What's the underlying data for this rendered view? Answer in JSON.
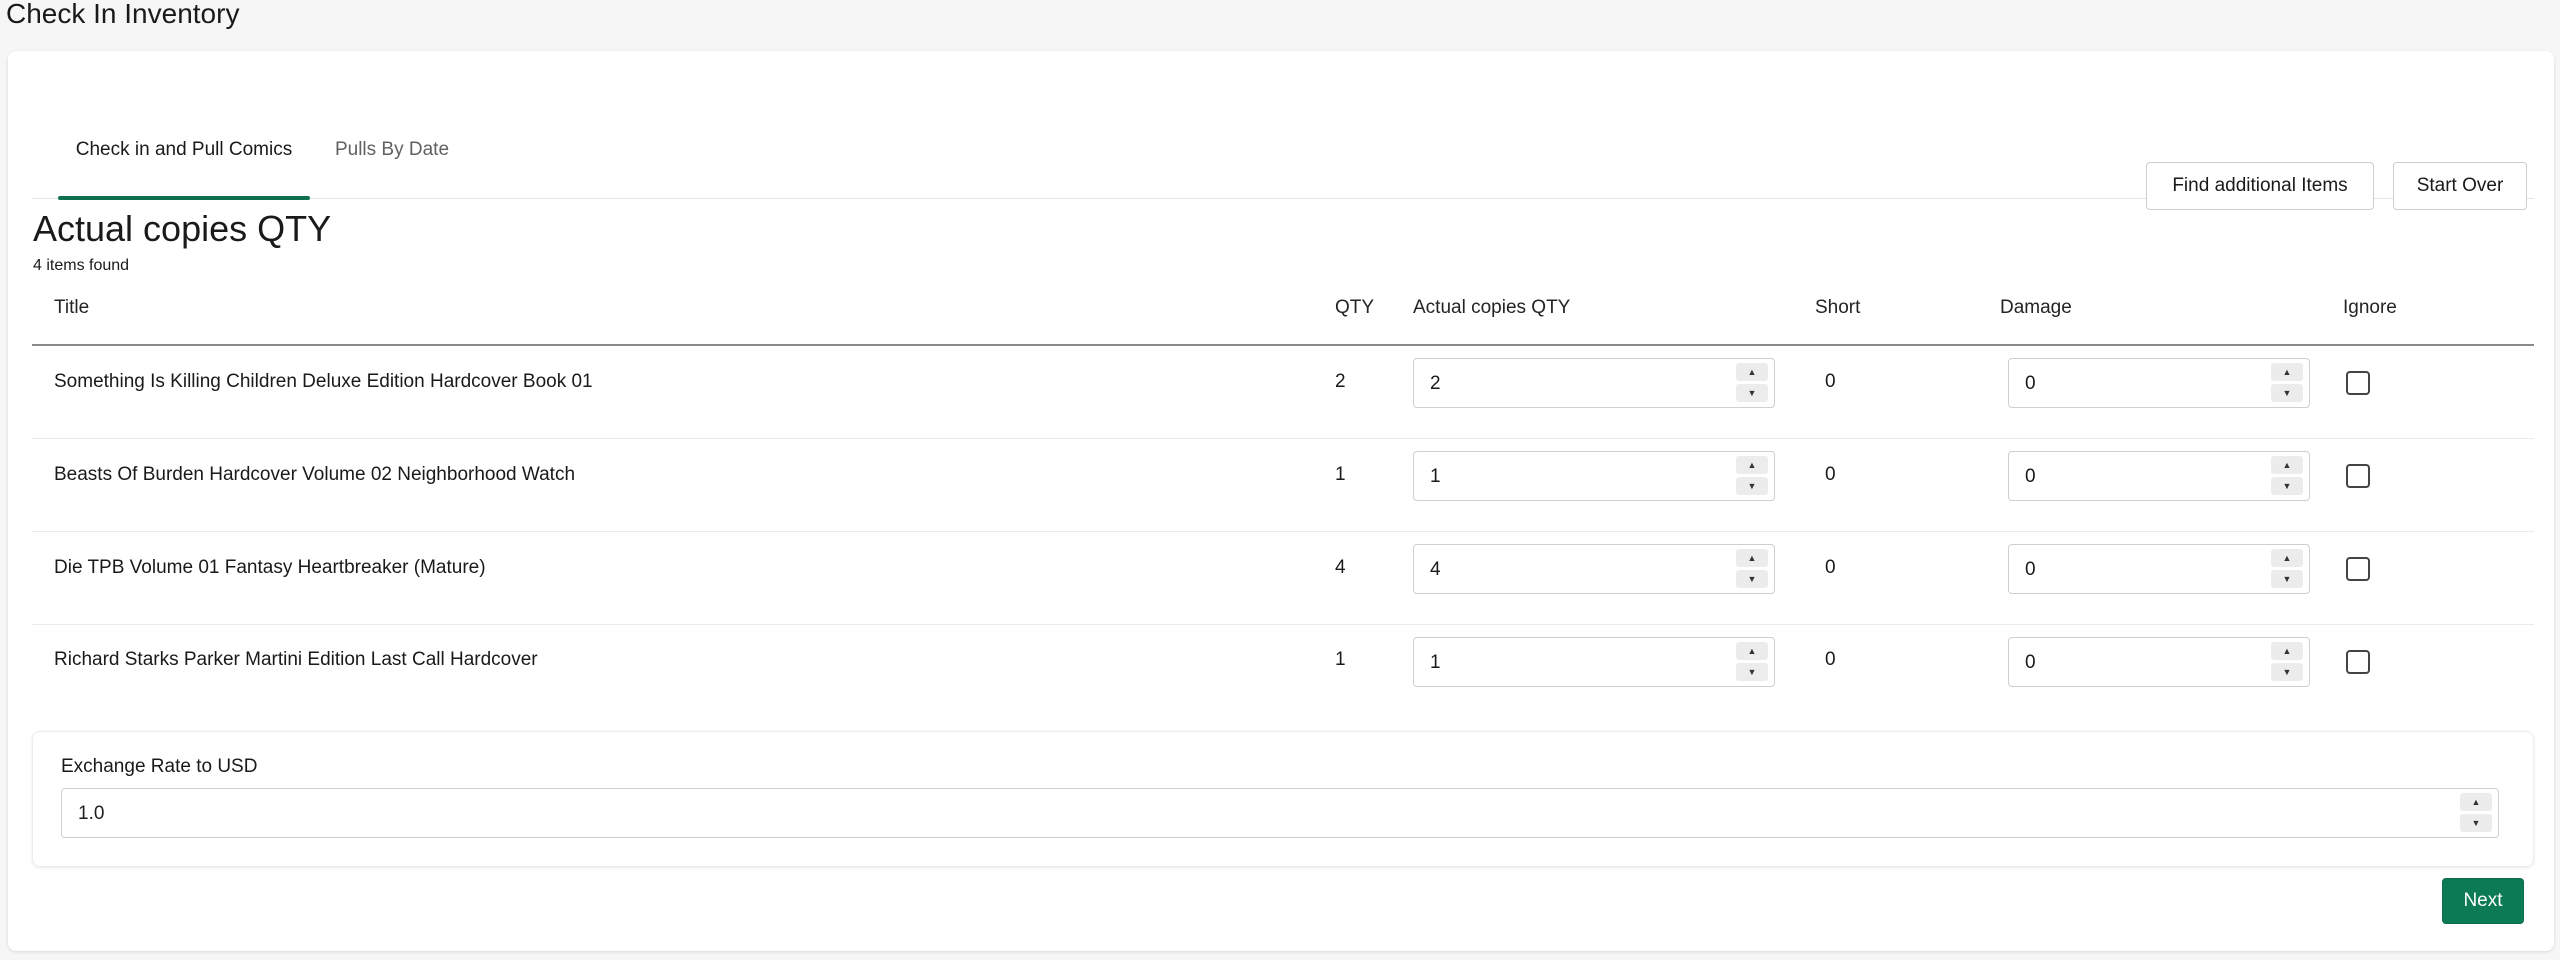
{
  "page": {
    "title": "Check In Inventory"
  },
  "tabs": [
    {
      "label": "Check in and Pull Comics",
      "active": true
    },
    {
      "label": "Pulls By Date",
      "active": false
    }
  ],
  "toolbar": {
    "find_label": "Find additional Items",
    "start_over_label": "Start Over"
  },
  "section": {
    "title": "Actual copies QTY",
    "count_text": "4 items found"
  },
  "table": {
    "headers": {
      "title": "Title",
      "qty": "QTY",
      "actual": "Actual copies QTY",
      "short": "Short",
      "damage": "Damage",
      "ignore": "Ignore"
    },
    "rows": [
      {
        "title": "Something Is Killing Children Deluxe Edition Hardcover Book 01",
        "qty": "2",
        "actual": "2",
        "short": "0",
        "damage": "0",
        "ignore": false
      },
      {
        "title": "Beasts Of Burden Hardcover Volume 02 Neighborhood Watch",
        "qty": "1",
        "actual": "1",
        "short": "0",
        "damage": "0",
        "ignore": false
      },
      {
        "title": "Die TPB Volume 01 Fantasy Heartbreaker (Mature)",
        "qty": "4",
        "actual": "4",
        "short": "0",
        "damage": "0",
        "ignore": false
      },
      {
        "title": "Richard Starks Parker Martini Edition Last Call Hardcover",
        "qty": "1",
        "actual": "1",
        "short": "0",
        "damage": "0",
        "ignore": false
      }
    ]
  },
  "exchange": {
    "label": "Exchange Rate to USD",
    "value": "1.0"
  },
  "footer": {
    "next_label": "Next"
  },
  "colors": {
    "accent": "#0b7a55",
    "tab_indicator": "#0f6f4f"
  },
  "icons": {
    "spin_up": "chevron-up-icon",
    "spin_down": "chevron-down-icon"
  }
}
